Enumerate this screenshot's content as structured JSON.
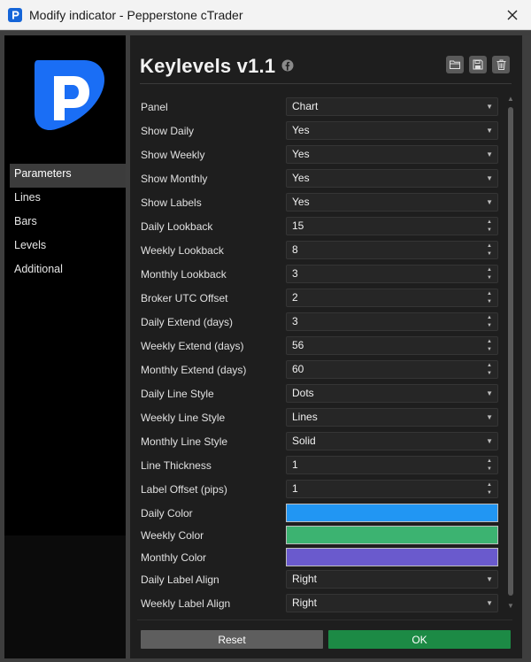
{
  "window": {
    "title": "Modify indicator - Pepperstone cTrader"
  },
  "sidebar": {
    "items": [
      {
        "label": "Parameters",
        "active": true
      },
      {
        "label": "Lines",
        "active": false
      },
      {
        "label": "Bars",
        "active": false
      },
      {
        "label": "Levels",
        "active": false
      },
      {
        "label": "Additional",
        "active": false
      }
    ]
  },
  "header": {
    "title": "Keylevels v1.1"
  },
  "params": [
    {
      "label": "Panel",
      "value": "Chart",
      "kind": "select"
    },
    {
      "label": "Show Daily",
      "value": "Yes",
      "kind": "select"
    },
    {
      "label": "Show Weekly",
      "value": "Yes",
      "kind": "select"
    },
    {
      "label": "Show Monthly",
      "value": "Yes",
      "kind": "select"
    },
    {
      "label": "Show Labels",
      "value": "Yes",
      "kind": "select"
    },
    {
      "label": "Daily Lookback",
      "value": "15",
      "kind": "number"
    },
    {
      "label": "Weekly Lookback",
      "value": "8",
      "kind": "number"
    },
    {
      "label": "Monthly Lookback",
      "value": "3",
      "kind": "number"
    },
    {
      "label": "Broker UTC Offset",
      "value": "2",
      "kind": "number"
    },
    {
      "label": "Daily Extend (days)",
      "value": "3",
      "kind": "number"
    },
    {
      "label": "Weekly Extend (days)",
      "value": "56",
      "kind": "number"
    },
    {
      "label": "Monthly Extend (days)",
      "value": "60",
      "kind": "number"
    },
    {
      "label": "Daily Line Style",
      "value": "Dots",
      "kind": "select"
    },
    {
      "label": "Weekly Line Style",
      "value": "Lines",
      "kind": "select"
    },
    {
      "label": "Monthly Line Style",
      "value": "Solid",
      "kind": "select"
    },
    {
      "label": "Line Thickness",
      "value": "1",
      "kind": "number"
    },
    {
      "label": "Label Offset (pips)",
      "value": "1",
      "kind": "number"
    },
    {
      "label": "Daily Color",
      "color": "#2196f3",
      "kind": "color"
    },
    {
      "label": "Weekly Color",
      "color": "#3cb371",
      "kind": "color"
    },
    {
      "label": "Monthly Color",
      "color": "#6a5acd",
      "kind": "color"
    },
    {
      "label": "Daily Label Align",
      "value": "Right",
      "kind": "select"
    },
    {
      "label": "Weekly Label Align",
      "value": "Right",
      "kind": "select"
    }
  ],
  "buttons": {
    "reset": "Reset",
    "ok": "OK"
  },
  "colors": {
    "brand": "#0064e6",
    "ok": "#1c8a45",
    "reset": "#5e5e5e"
  }
}
